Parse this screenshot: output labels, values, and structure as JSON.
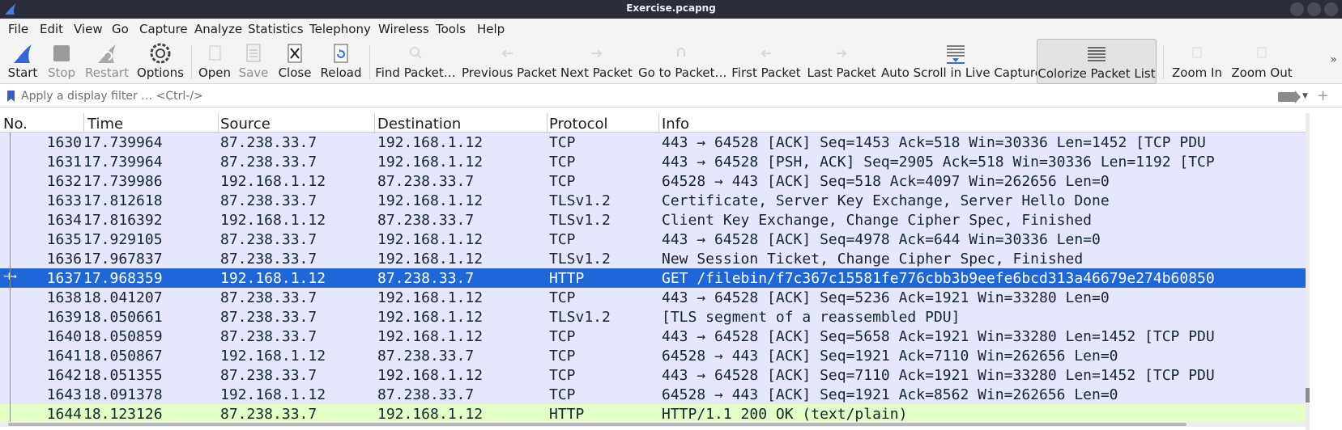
{
  "window": {
    "title": "Exercise.pcapng",
    "app_icon": "wireshark-fin-icon"
  },
  "menu": {
    "items": [
      {
        "label": "File",
        "key": "F"
      },
      {
        "label": "Edit",
        "key": "E"
      },
      {
        "label": "View",
        "key": "V"
      },
      {
        "label": "Go",
        "key": "G"
      },
      {
        "label": "Capture",
        "key": "C"
      },
      {
        "label": "Analyze",
        "key": "A"
      },
      {
        "label": "Statistics",
        "key": "S"
      },
      {
        "label": "Telephony",
        "key": "y"
      },
      {
        "label": "Wireless",
        "key": "W"
      },
      {
        "label": "Tools",
        "key": "T"
      },
      {
        "label": "Help",
        "key": "H"
      }
    ]
  },
  "toolbar": {
    "start": "Start",
    "stop": "Stop",
    "restart": "Restart",
    "options": "Options",
    "open": "Open",
    "save": "Save",
    "close": "Close",
    "reload": "Reload",
    "find_packet": "Find Packet…",
    "previous_packet": "Previous Packet",
    "next_packet": "Next Packet",
    "go_to_packet": "Go to Packet…",
    "first_packet": "First Packet",
    "last_packet": "Last Packet",
    "auto_scroll": "Auto Scroll in Live Capture",
    "colorize": "Colorize Packet List",
    "zoom_in": "Zoom In",
    "zoom_out": "Zoom Out",
    "more": "»"
  },
  "filter": {
    "placeholder": "Apply a display filter … <Ctrl-/>",
    "value": ""
  },
  "packet_list": {
    "columns": [
      "No.",
      "Time",
      "Source",
      "Destination",
      "Protocol",
      "Info"
    ],
    "rows": [
      {
        "no": "1630",
        "time": "17.739964",
        "src": "87.238.33.7",
        "dst": "192.168.1.12",
        "proto": "TCP",
        "info": "443 → 64528 [ACK] Seq=1453 Ack=518 Win=30336 Len=1452 [TCP PDU",
        "color": "tcp"
      },
      {
        "no": "1631",
        "time": "17.739964",
        "src": "87.238.33.7",
        "dst": "192.168.1.12",
        "proto": "TCP",
        "info": "443 → 64528 [PSH, ACK] Seq=2905 Ack=518 Win=30336 Len=1192 [TCP",
        "color": "tcp"
      },
      {
        "no": "1632",
        "time": "17.739986",
        "src": "192.168.1.12",
        "dst": "87.238.33.7",
        "proto": "TCP",
        "info": "64528 → 443 [ACK] Seq=518 Ack=4097 Win=262656 Len=0",
        "color": "tcp"
      },
      {
        "no": "1633",
        "time": "17.812618",
        "src": "87.238.33.7",
        "dst": "192.168.1.12",
        "proto": "TLSv1.2",
        "info": "Certificate, Server Key Exchange, Server Hello Done",
        "color": "tcp"
      },
      {
        "no": "1634",
        "time": "17.816392",
        "src": "192.168.1.12",
        "dst": "87.238.33.7",
        "proto": "TLSv1.2",
        "info": "Client Key Exchange, Change Cipher Spec, Finished",
        "color": "tcp"
      },
      {
        "no": "1635",
        "time": "17.929105",
        "src": "87.238.33.7",
        "dst": "192.168.1.12",
        "proto": "TCP",
        "info": "443 → 64528 [ACK] Seq=4978 Ack=644 Win=30336 Len=0",
        "color": "tcp"
      },
      {
        "no": "1636",
        "time": "17.967837",
        "src": "87.238.33.7",
        "dst": "192.168.1.12",
        "proto": "TLSv1.2",
        "info": "New Session Ticket, Change Cipher Spec, Finished",
        "color": "tcp"
      },
      {
        "no": "1637",
        "time": "17.968359",
        "src": "192.168.1.12",
        "dst": "87.238.33.7",
        "proto": "HTTP",
        "info": "GET /filebin/f7c367c15581fe776cbb3b9eefe6bcd313a46679e274b60850",
        "color": "selected"
      },
      {
        "no": "1638",
        "time": "18.041207",
        "src": "87.238.33.7",
        "dst": "192.168.1.12",
        "proto": "TCP",
        "info": "443 → 64528 [ACK] Seq=5236 Ack=1921 Win=33280 Len=0",
        "color": "tcp"
      },
      {
        "no": "1639",
        "time": "18.050661",
        "src": "87.238.33.7",
        "dst": "192.168.1.12",
        "proto": "TLSv1.2",
        "info": "[TLS segment of a reassembled PDU]",
        "color": "tcp"
      },
      {
        "no": "1640",
        "time": "18.050859",
        "src": "87.238.33.7",
        "dst": "192.168.1.12",
        "proto": "TCP",
        "info": "443 → 64528 [ACK] Seq=5658 Ack=1921 Win=33280 Len=1452 [TCP PDU",
        "color": "tcp"
      },
      {
        "no": "1641",
        "time": "18.050867",
        "src": "192.168.1.12",
        "dst": "87.238.33.7",
        "proto": "TCP",
        "info": "64528 → 443 [ACK] Seq=1921 Ack=7110 Win=262656 Len=0",
        "color": "tcp"
      },
      {
        "no": "1642",
        "time": "18.051355",
        "src": "87.238.33.7",
        "dst": "192.168.1.12",
        "proto": "TCP",
        "info": "443 → 64528 [ACK] Seq=7110 Ack=1921 Win=33280 Len=1452 [TCP PDU",
        "color": "tcp"
      },
      {
        "no": "1643",
        "time": "18.091378",
        "src": "192.168.1.12",
        "dst": "87.238.33.7",
        "proto": "TCP",
        "info": "64528 → 443 [ACK] Seq=1921 Ack=8562 Win=262656 Len=0",
        "color": "tcp"
      },
      {
        "no": "1644",
        "time": "18.123126",
        "src": "87.238.33.7",
        "dst": "192.168.1.12",
        "proto": "HTTP",
        "info": "HTTP/1.1 200 OK  (text/plain)",
        "color": "http"
      }
    ]
  },
  "colors": {
    "tcp_row": "#e7e6ff",
    "http_row": "#e4ffc7",
    "selected_row": "#1f66d8",
    "title_bar": "#2b2d3a"
  }
}
